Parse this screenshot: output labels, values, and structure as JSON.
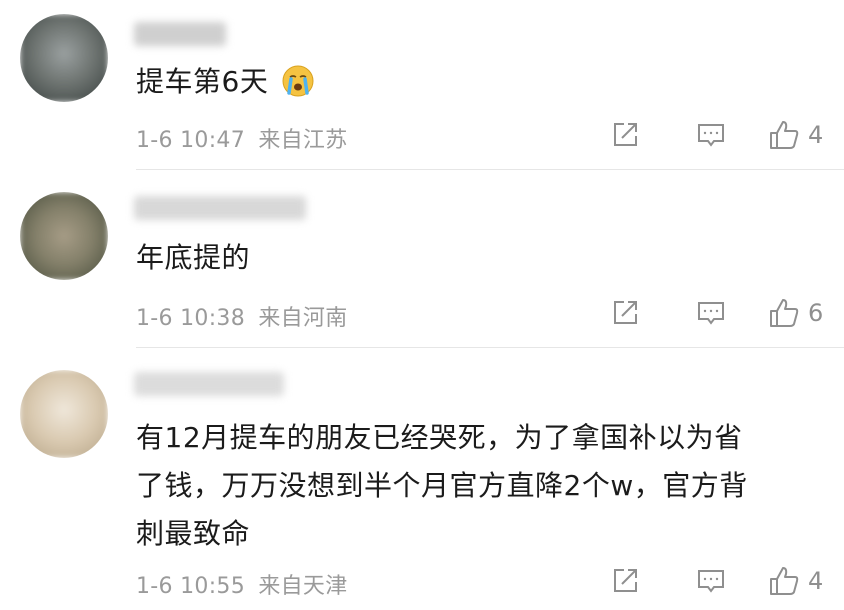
{
  "comments": [
    {
      "text": "提车第6天",
      "emoji": "crying-emoji",
      "time": "1-6 10:47",
      "location": "来自江苏",
      "likes": "4"
    },
    {
      "text": "年底提的",
      "time": "1-6 10:38",
      "location": "来自河南",
      "likes": "6"
    },
    {
      "text_line1": "有12月提车的朋友已经哭死，为了拿国补以为省",
      "text_line2": "了钱，万万没想到半个月官方直降2个w，官方背",
      "text_line3": "刺最致命",
      "time": "1-6 10:55",
      "location": "来自天津",
      "likes": "4"
    }
  ],
  "icons": {
    "share": "share-icon",
    "reply": "reply-icon",
    "like": "thumbs-up-icon"
  },
  "colors": {
    "text": "#1b1b1b",
    "meta": "#9a9a9a",
    "divider": "#e6e6e6"
  }
}
